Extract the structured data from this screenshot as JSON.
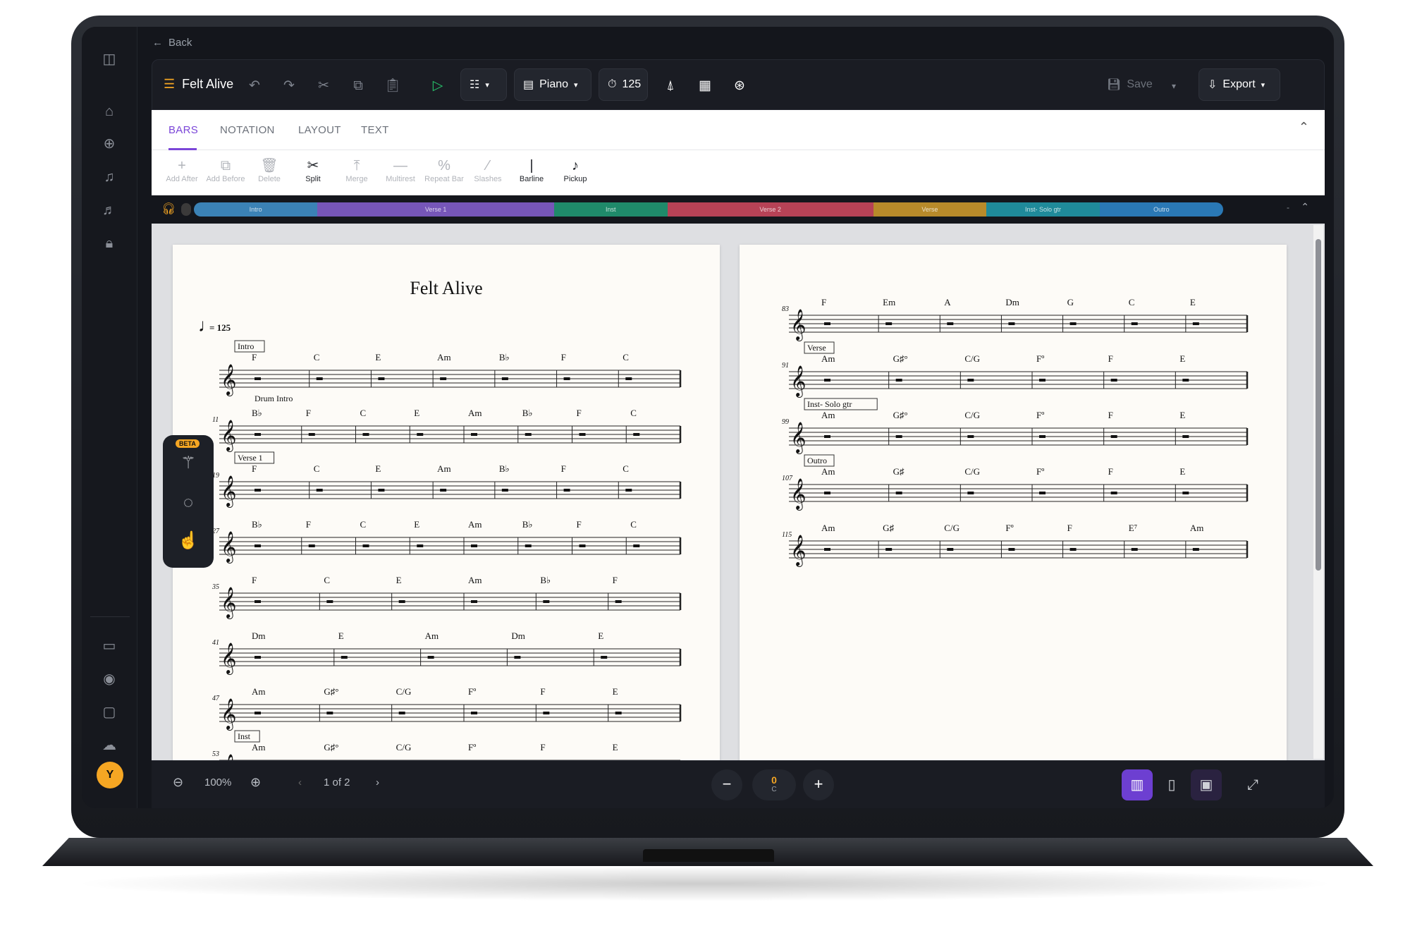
{
  "app": {
    "back_label": "Back",
    "title": "Felt Alive"
  },
  "toolbar": {
    "instrument": "Piano",
    "tempo": "125",
    "save_label": "Save",
    "export_label": "Export"
  },
  "tabs": [
    "BARS",
    "NOTATION",
    "LAYOUT",
    "TEXT"
  ],
  "tools": [
    {
      "label": "Add After",
      "icon": "+",
      "enabled": false
    },
    {
      "label": "Add Before",
      "icon": "⧉",
      "enabled": false
    },
    {
      "label": "Delete",
      "icon": "🗑",
      "enabled": false
    },
    {
      "label": "Split",
      "icon": "✂",
      "enabled": true
    },
    {
      "label": "Merge",
      "icon": "⤒",
      "enabled": false
    },
    {
      "label": "Multirest",
      "icon": "—",
      "enabled": false
    },
    {
      "label": "Repeat Bar",
      "icon": "%",
      "enabled": false
    },
    {
      "label": "Slashes",
      "icon": "⁄",
      "enabled": false
    },
    {
      "label": "Barline",
      "icon": "|",
      "enabled": true
    },
    {
      "label": "Pickup",
      "icon": "♪",
      "enabled": true
    }
  ],
  "sections": [
    {
      "name": "Intro",
      "color": "#3b82b6",
      "share": 0.12
    },
    {
      "name": "Verse 1",
      "color": "#7656b8",
      "share": 0.23
    },
    {
      "name": "Inst",
      "color": "#1f8a6a",
      "share": 0.11
    },
    {
      "name": "Verse 2",
      "color": "#b74256",
      "share": 0.2
    },
    {
      "name": "Verse",
      "color": "#b88a2a",
      "share": 0.11
    },
    {
      "name": "Inst- Solo gtr",
      "color": "#1f8a9a",
      "share": 0.11
    },
    {
      "name": "Outro",
      "color": "#2a78b5",
      "share": 0.12
    }
  ],
  "score": {
    "title": "Felt Alive",
    "tempo_mark": "= 125",
    "drum_text": "Drum Intro",
    "left_systems": [
      {
        "bar": "",
        "label": "Intro",
        "chords": [
          "F",
          "C",
          "E",
          "Am",
          "B♭",
          "F",
          "C"
        ]
      },
      {
        "bar": "11",
        "label": "",
        "chords": [
          "B♭",
          "F",
          "C",
          "E",
          "Am",
          "B♭",
          "F",
          "C"
        ]
      },
      {
        "bar": "19",
        "label": "Verse 1",
        "chords": [
          "F",
          "C",
          "E",
          "Am",
          "B♭",
          "F",
          "C"
        ]
      },
      {
        "bar": "27",
        "label": "",
        "chords": [
          "B♭",
          "F",
          "C",
          "E",
          "Am",
          "B♭",
          "F",
          "C"
        ]
      },
      {
        "bar": "35",
        "label": "",
        "chords": [
          "F",
          "C",
          "E",
          "Am",
          "B♭",
          "F"
        ]
      },
      {
        "bar": "41",
        "label": "",
        "chords": [
          "Dm",
          "E",
          "Am",
          "Dm",
          "E"
        ]
      },
      {
        "bar": "47",
        "label": "",
        "chords": [
          "Am",
          "G♯°",
          "C/G",
          "Fº",
          "F",
          "E"
        ]
      },
      {
        "bar": "53",
        "label": "Inst",
        "chords": [
          "Am",
          "G♯°",
          "C/G",
          "Fº",
          "F",
          "E"
        ]
      }
    ],
    "right_systems": [
      {
        "bar": "83",
        "label": "",
        "chords": [
          "F",
          "Em",
          "A",
          "Dm",
          "G",
          "C",
          "E"
        ]
      },
      {
        "bar": "91",
        "label": "Verse",
        "chords": [
          "Am",
          "G♯°",
          "C/G",
          "Fº",
          "F",
          "E"
        ]
      },
      {
        "bar": "99",
        "label": "Inst- Solo gtr",
        "chords": [
          "Am",
          "G♯°",
          "C/G",
          "Fº",
          "F",
          "E"
        ]
      },
      {
        "bar": "107",
        "label": "Outro",
        "chords": [
          "Am",
          "G♯",
          "C/G",
          "Fº",
          "F",
          "E"
        ]
      },
      {
        "bar": "115",
        "label": "",
        "chords": [
          "Am",
          "G♯",
          "C/G",
          "Fº",
          "F",
          "E⁷",
          "Am"
        ]
      }
    ]
  },
  "bottombar": {
    "zoom": "100%",
    "page_indicator": "1 of 2",
    "transpose_value": "0",
    "transpose_key": "C"
  },
  "user": {
    "initial": "Y"
  }
}
